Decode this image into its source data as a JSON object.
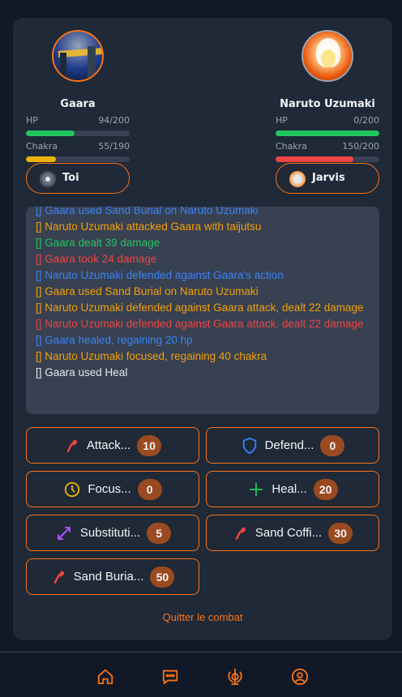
{
  "player1": {
    "name": "Gaara",
    "hp_label": "HP",
    "hp_text": "94/200",
    "hp_fraction": 0.47,
    "chakra_label": "Chakra",
    "chakra_text": "55/190",
    "chakra_fraction": 0.29,
    "tag": "Toi"
  },
  "player2": {
    "name": "Naruto Uzumaki",
    "hp_label": "HP",
    "hp_text": "0/200",
    "hp_fraction": 1.0,
    "chakra_label": "Chakra",
    "chakra_text": "150/200",
    "chakra_fraction": 0.75,
    "tag": "Jarvis"
  },
  "colors": {
    "accent": "#f97316",
    "hp": "#22c55e",
    "chakra_p1": "#eab308",
    "chakra_p2": "#ef4444",
    "badge": "#9a4a20",
    "log_blue": "#3b82f6",
    "log_orange": "#f59e0b",
    "log_green": "#22c55e",
    "log_red": "#ef4444",
    "log_white": "#e5e7eb"
  },
  "log": [
    {
      "text": "[] Gaara used Sand Burial on Naruto Uzumaki",
      "color": "blue"
    },
    {
      "text": "[] Naruto Uzumaki attacked Gaara with taijutsu",
      "color": "orange"
    },
    {
      "text": "[] Gaara dealt 39 damage",
      "color": "green"
    },
    {
      "text": "[] Gaara took 24 damage",
      "color": "red"
    },
    {
      "text": "[] Naruto Uzumaki defended against Gaara's action",
      "color": "blue"
    },
    {
      "text": "[] Gaara used Sand Burial on Naruto Uzumaki",
      "color": "orange"
    },
    {
      "text": "[] Naruto Uzumaki defended against Gaara attack, dealt 22 damage",
      "color": "orange"
    },
    {
      "text": "[] Naruto Uzumaki defended against Gaara attack, dealt 22 damage",
      "color": "red"
    },
    {
      "text": "[] Gaara healed, regaining 20 hp",
      "color": "blue"
    },
    {
      "text": "[] Naruto Uzumaki focused, regaining 40 chakra",
      "color": "orange"
    },
    {
      "text": "[] Gaara used Heal",
      "color": "white"
    }
  ],
  "actions": [
    {
      "label": "Attack...",
      "count": "10",
      "icon": "attack-icon"
    },
    {
      "label": "Defend...",
      "count": "0",
      "icon": "shield-icon"
    },
    {
      "label": "Focus...",
      "count": "0",
      "icon": "clock-icon"
    },
    {
      "label": "Heal...",
      "count": "20",
      "icon": "plus-icon"
    },
    {
      "label": "Substituti...",
      "count": "5",
      "icon": "swap-icon"
    },
    {
      "label": "Sand Coffi...",
      "count": "30",
      "icon": "attack-icon"
    },
    {
      "label": "Sand Buria...",
      "count": "50",
      "icon": "attack-icon"
    }
  ],
  "quit_label": "Quitter le combat",
  "nav": [
    {
      "icon": "home-icon"
    },
    {
      "icon": "chat-icon"
    },
    {
      "icon": "khanda-icon"
    },
    {
      "icon": "profile-icon"
    }
  ]
}
